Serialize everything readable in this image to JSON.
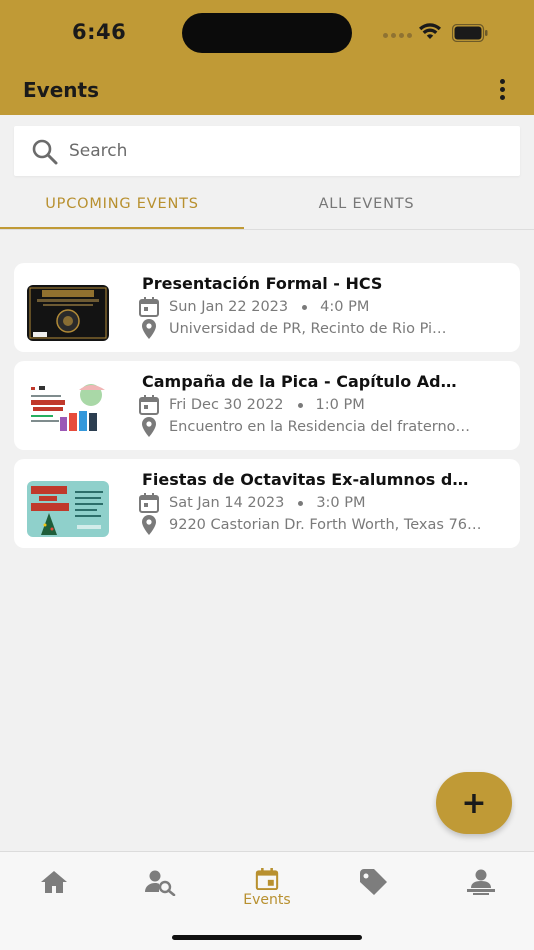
{
  "status_bar": {
    "time": "6:46"
  },
  "app_bar": {
    "title": "Events",
    "menu_icon": "more-vert-icon"
  },
  "search": {
    "placeholder": "Search",
    "value": ""
  },
  "tabs": [
    {
      "label": "UPCOMING EVENTS",
      "active": true
    },
    {
      "label": "ALL EVENTS",
      "active": false
    }
  ],
  "events": [
    {
      "title": "Presentación Formal - HCS",
      "date": "Sun Jan 22 2023",
      "time": "4:0 PM",
      "location": "Universidad de PR, Recinto de Rio Pi…"
    },
    {
      "title": "Campaña de la Pica - Capítulo Ad…",
      "date": "Fri Dec 30 2022",
      "time": "1:0 PM",
      "location": "Encuentro en la Residencia del fraterno…"
    },
    {
      "title": "Fiestas de Octavitas Ex-alumnos d…",
      "date": "Sat Jan 14 2023",
      "time": "3:0 PM",
      "location": "9220 Castorian Dr. Forth Worth, Texas 76…"
    }
  ],
  "fab": {
    "label": "+"
  },
  "bottom_nav": [
    {
      "icon": "home-icon",
      "label": "",
      "active": false
    },
    {
      "icon": "person-search-icon",
      "label": "",
      "active": false
    },
    {
      "icon": "calendar-icon",
      "label": "Events",
      "active": true
    },
    {
      "icon": "tag-icon",
      "label": "",
      "active": false
    },
    {
      "icon": "person-desk-icon",
      "label": "",
      "active": false
    }
  ],
  "colors": {
    "primary": "#c09a36",
    "active_text": "#b8902f",
    "background": "#f1f1f1",
    "nav_inactive": "#7d7d7d"
  }
}
